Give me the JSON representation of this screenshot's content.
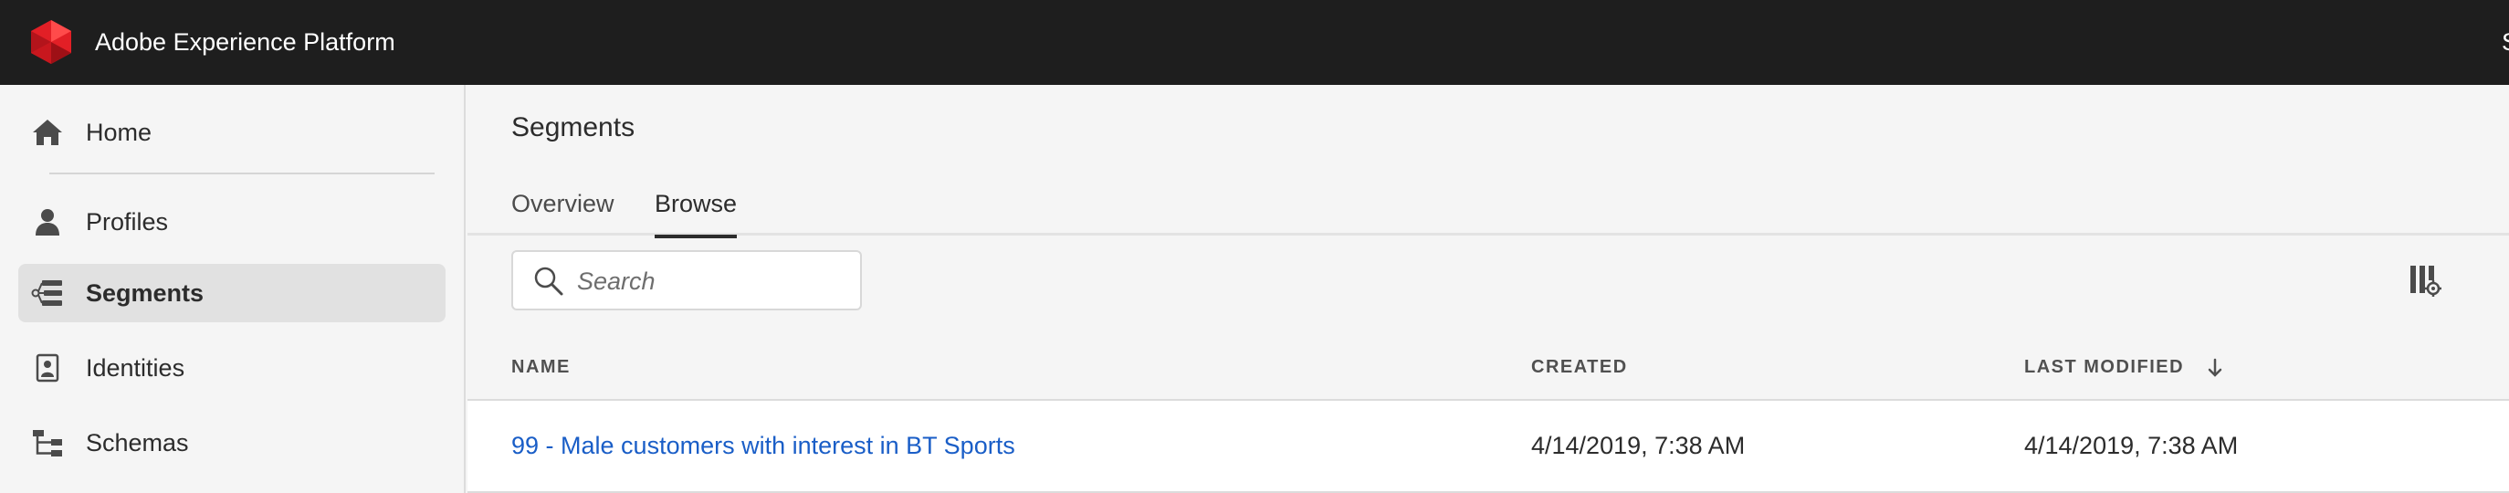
{
  "app": {
    "title": "Adobe Experience Platform",
    "right_text": "S"
  },
  "sidebar": {
    "items": [
      {
        "label": "Home",
        "icon": "home-icon",
        "active": false
      },
      {
        "label": "Profiles",
        "icon": "person-icon",
        "active": false
      },
      {
        "label": "Segments",
        "icon": "segments-icon",
        "active": true
      },
      {
        "label": "Identities",
        "icon": "identity-card-icon",
        "active": false
      },
      {
        "label": "Schemas",
        "icon": "schema-tree-icon",
        "active": false
      }
    ]
  },
  "page": {
    "title": "Segments",
    "tabs": [
      {
        "label": "Overview",
        "selected": false
      },
      {
        "label": "Browse",
        "selected": true
      }
    ]
  },
  "search": {
    "placeholder": "Search",
    "value": ""
  },
  "table": {
    "columns": [
      "NAME",
      "CREATED",
      "LAST MODIFIED"
    ],
    "sorted_column": "LAST MODIFIED",
    "sort_direction": "descending",
    "rows": [
      {
        "name": "99 - Male customers with interest in BT Sports",
        "created": "4/14/2019, 7:38 AM",
        "last_modified": "4/14/2019, 7:38 AM"
      }
    ]
  },
  "colors": {
    "topbar": "#1e1e1e",
    "logo": "#e21f26",
    "link": "#1a5ec7",
    "active_nav_bg": "#e1e1e1"
  }
}
